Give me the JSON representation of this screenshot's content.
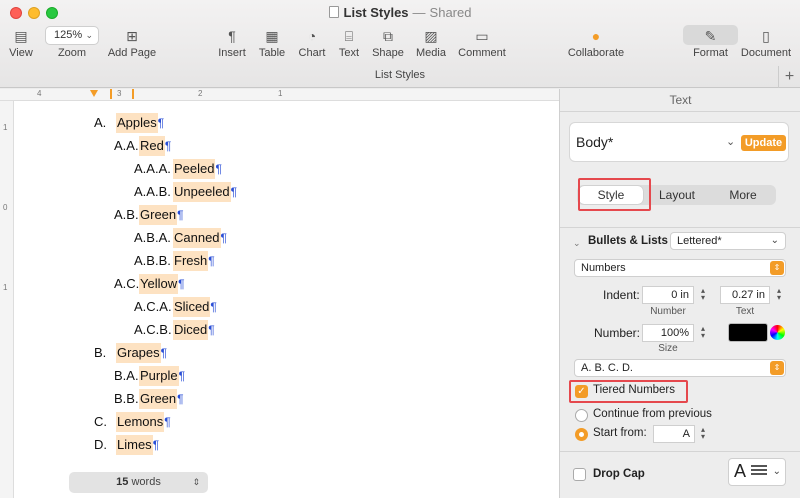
{
  "window": {
    "title": "List Styles",
    "separator": "—",
    "status": "Shared"
  },
  "toolbar": {
    "view": "View",
    "zoom_value": "125%",
    "zoom": "Zoom",
    "add_page": "Add Page",
    "insert": "Insert",
    "table": "Table",
    "chart": "Chart",
    "text": "Text",
    "shape": "Shape",
    "media": "Media",
    "comment": "Comment",
    "collaborate": "Collaborate",
    "format": "Format",
    "document": "Document",
    "subtitle": "List Styles"
  },
  "ruler": {
    "top_numbers": [
      "4",
      "3",
      "2",
      "1"
    ],
    "left_numbers": [
      "1",
      "0",
      "1"
    ]
  },
  "document": {
    "pilcrow": "¶",
    "lines": [
      {
        "num": "A.",
        "text": "Apples"
      },
      {
        "num": "A.A.",
        "text": "Red"
      },
      {
        "num": "A.A.A.",
        "text": "Peeled"
      },
      {
        "num": "A.A.B.",
        "text": "Unpeeled"
      },
      {
        "num": "A.B.",
        "text": "Green"
      },
      {
        "num": "A.B.A.",
        "text": "Canned"
      },
      {
        "num": "A.B.B.",
        "text": "Fresh"
      },
      {
        "num": "A.C.",
        "text": "Yellow"
      },
      {
        "num": "A.C.A.",
        "text": "Sliced"
      },
      {
        "num": "A.C.B.",
        "text": "Diced"
      },
      {
        "num": "B.",
        "text": "Grapes"
      },
      {
        "num": "B.A.",
        "text": "Purple"
      },
      {
        "num": "B.B.",
        "text": "Green"
      },
      {
        "num": "C.",
        "text": "Lemons"
      },
      {
        "num": "D.",
        "text": "Limes"
      }
    ],
    "word_count": "15",
    "word_label": "words"
  },
  "sidebar": {
    "title": "Text",
    "paragraph_style": "Body*",
    "update": "Update",
    "tabs": [
      "Style",
      "Layout",
      "More"
    ],
    "bullets_label": "Bullets & Lists",
    "bullets_value": "Lettered*",
    "list_type": "Numbers",
    "indent_label": "Indent:",
    "indent_number": "0 in",
    "indent_text": "0.27 in",
    "number_caption": "Number",
    "text_caption": "Text",
    "number_label": "Number:",
    "size_value": "100%",
    "size_caption": "Size",
    "format_value": "A. B. C. D.",
    "tiered": "Tiered Numbers",
    "continue": "Continue from previous",
    "start_from": "Start from:",
    "start_value": "A",
    "drop_cap": "Drop Cap",
    "drop_cap_letter": "A"
  }
}
